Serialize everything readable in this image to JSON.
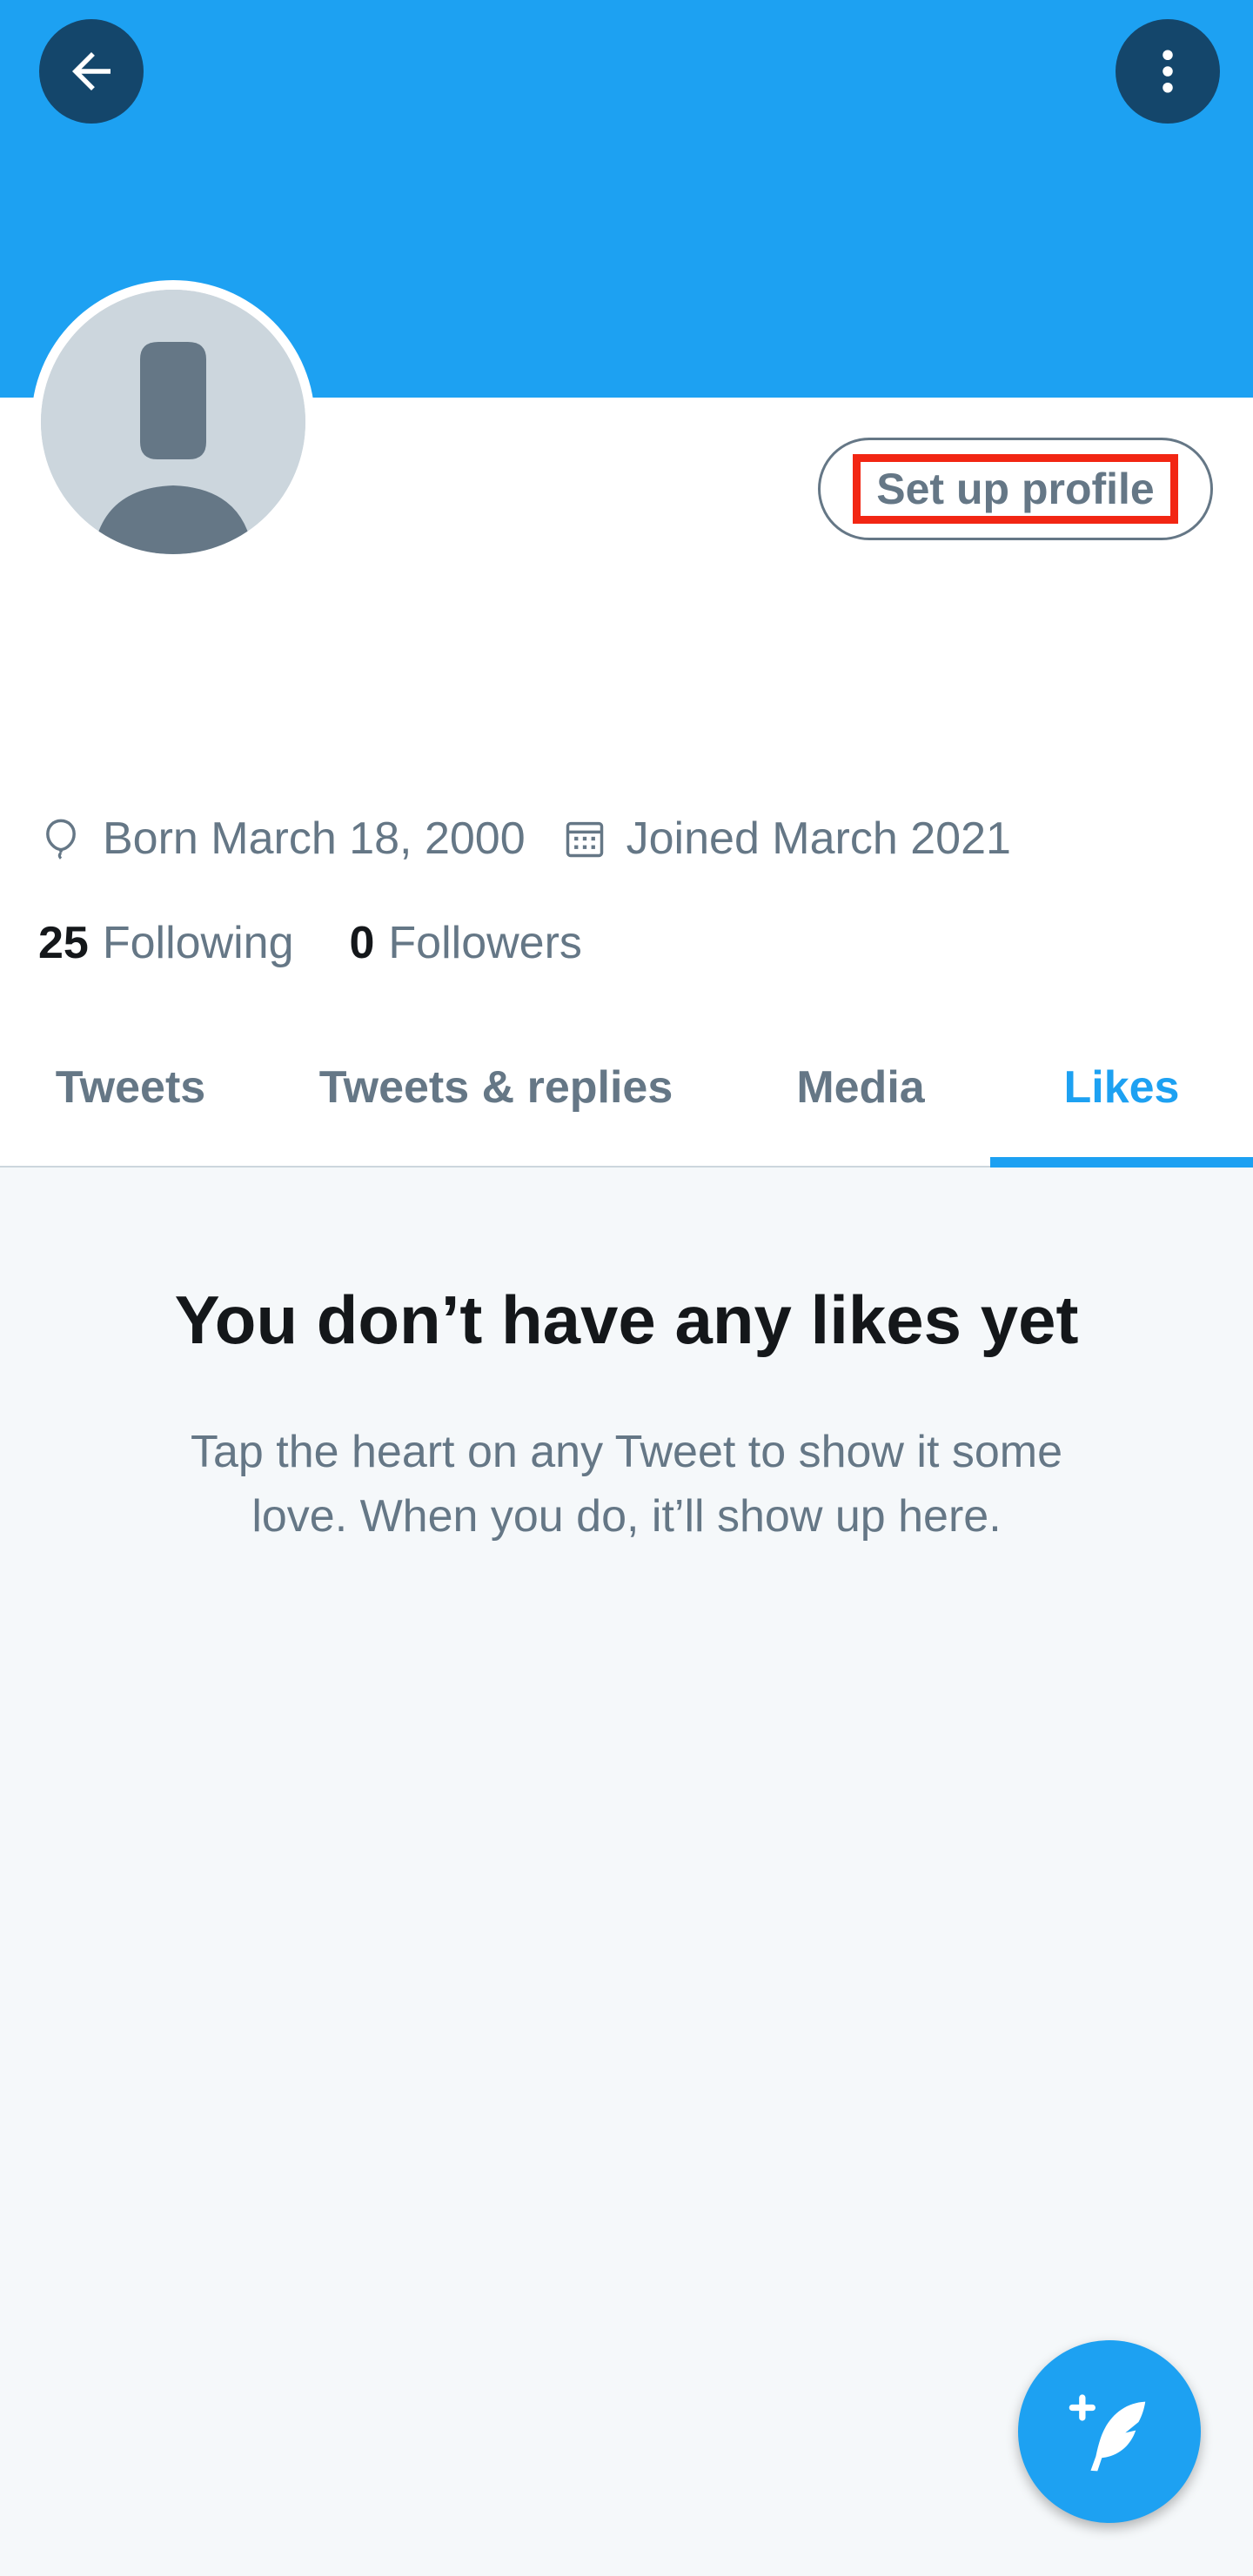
{
  "colors": {
    "accent": "#1da1f2",
    "icon_button_bg": "#14466b",
    "secondary_text": "#657786",
    "primary_text": "#14171a",
    "highlight_box": "#f22613",
    "content_bg": "#f5f8fa"
  },
  "header": {
    "back_icon": "arrow-left-icon",
    "more_icon": "more-vertical-icon"
  },
  "profile": {
    "avatar_icon": "default-avatar-icon",
    "setup_button_label": "Set up profile",
    "birthday_icon": "balloon-icon",
    "birthday": "Born March 18, 2000",
    "joined_icon": "calendar-icon",
    "joined": "Joined March 2021",
    "following_count": "25",
    "following_label": "Following",
    "followers_count": "0",
    "followers_label": "Followers"
  },
  "tabs": [
    {
      "label": "Tweets",
      "active": false
    },
    {
      "label": "Tweets & replies",
      "active": false
    },
    {
      "label": "Media",
      "active": false
    },
    {
      "label": "Likes",
      "active": true
    }
  ],
  "empty_state": {
    "title": "You don’t have any likes yet",
    "line1": "Tap the heart on any Tweet to show it some",
    "line2": "love. When you do, it’ll show up here."
  },
  "fab": {
    "icon": "compose-tweet-icon"
  }
}
